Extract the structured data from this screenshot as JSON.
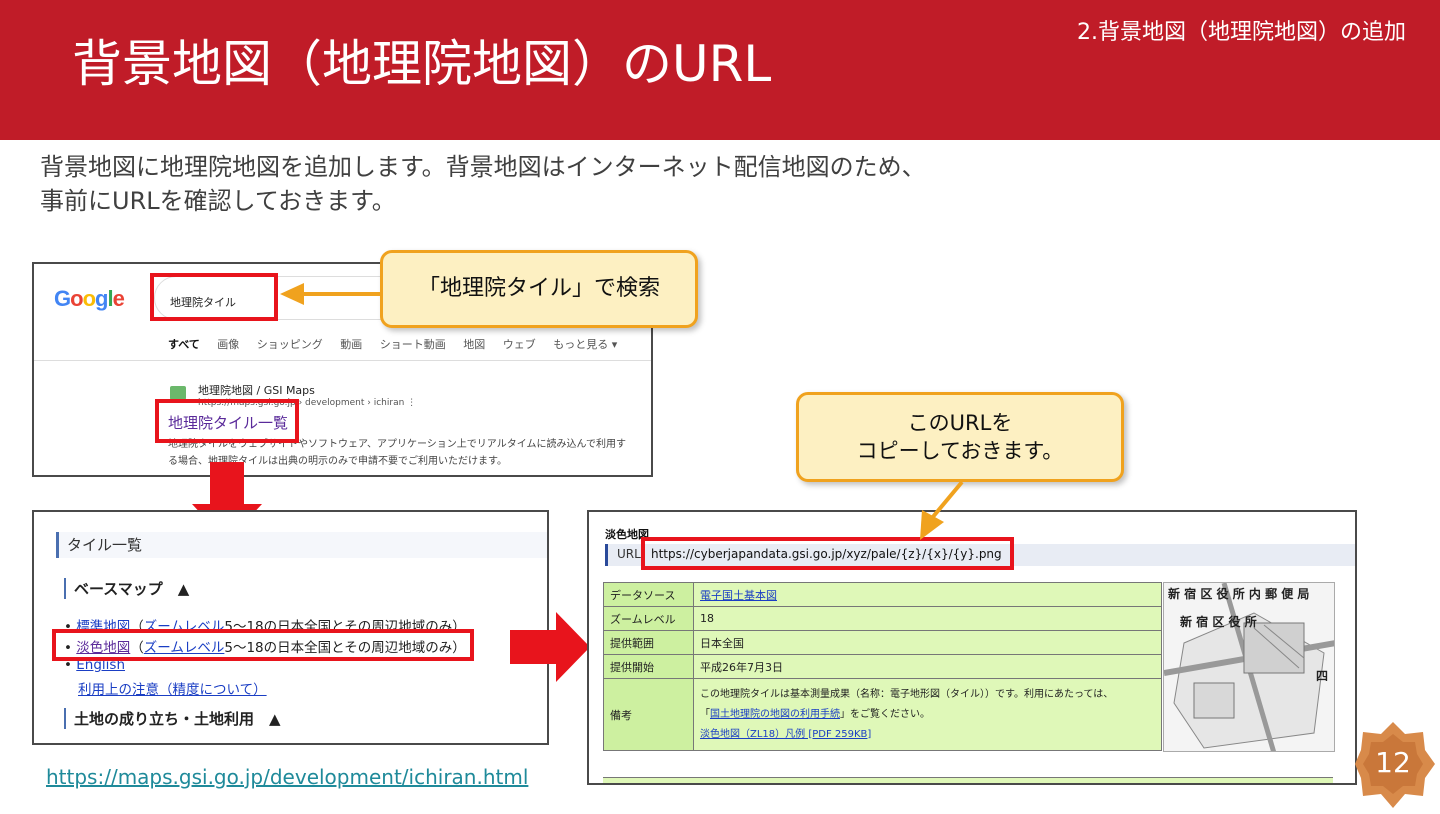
{
  "header": {
    "title": "背景地図（地理院地図）のURL",
    "section_tag": "2.背景地図（地理院地図）の追加"
  },
  "intro": {
    "line1": "背景地図に地理院地図を追加します。背景地図はインターネット配信地図のため、",
    "line2": "事前にURLを確認しておきます。"
  },
  "google_shot": {
    "logo": "Google",
    "search_value": "地理院タイル",
    "tabs": [
      "すべて",
      "画像",
      "ショッピング",
      "動画",
      "ショート動画",
      "地図",
      "ウェブ",
      "もっと見る ▾"
    ],
    "result": {
      "site_name": "地理院地図 / GSI Maps",
      "site_url": "https://maps.gsi.go.jp › development › ichiran  ⋮",
      "link_title": "地理院タイル一覧",
      "snippet_1": "地理院タイルをウェブサイトやソフトウェア、アプリケーション上でリアルタイムに読み込んで利用す",
      "snippet_2": "る場合、地理院タイルは出典の明示のみで申請不要でご利用いただけます。"
    }
  },
  "callout_search": "「地理院タイル」で検索",
  "callout_copy": {
    "line1": "このURLを",
    "line2": "コピーしておきます。"
  },
  "tile_list": {
    "heading": "タイル一覧",
    "base_map": "ベースマップ　▲",
    "items": [
      {
        "link": "標準地図",
        "paren": "（",
        "link2": "ズームレベル",
        "rest": "5～18の日本全国とその周辺地域のみ）"
      },
      {
        "link": "淡色地図",
        "paren": "（",
        "link2": "ズームレベル",
        "rest": "5～18の日本全国とその周辺地域のみ）"
      },
      {
        "link": "English"
      }
    ],
    "note_link": "利用上の注意（精度について）",
    "land_use": "土地の成り立ち・土地利用　▲"
  },
  "detail_shot": {
    "name": "淡色地図",
    "url_label": "URL",
    "url": "https://cyberjapandata.gsi.go.jp/xyz/pale/{z}/{x}/{y}.png",
    "rows": [
      {
        "key": "データソース",
        "value": "電子国土基本図"
      },
      {
        "key": "ズームレベル",
        "value": "18"
      },
      {
        "key": "提供範囲",
        "value": "日本全国"
      },
      {
        "key": "提供開始",
        "value": "平成26年7月3日"
      }
    ],
    "note_key": "備考",
    "note_1": "この地理院タイルは基本測量成果（名称：電子地形図（タイル））です。利用にあたっては、",
    "note_2_pre": "「",
    "note_2_link": "国土地理院の地図の利用手続",
    "note_2_post": "」をご覧ください。",
    "note_3": "淡色地図（ZL18）凡例 [PDF 259KB]",
    "map_label_1": "新 宿 区 役 所 内 郵 便 局",
    "map_label_2": "新 宿 区 役 所",
    "map_label_3": "四"
  },
  "source_link": "https://maps.gsi.go.jp/development/ichiran.html",
  "page_number": "12",
  "colors": {
    "header_red": "#c01c28",
    "highlight_red": "#e8141c",
    "callout_fill": "#fdf0c2",
    "callout_border": "#f0a21e",
    "arrow_red": "#e8141c"
  }
}
